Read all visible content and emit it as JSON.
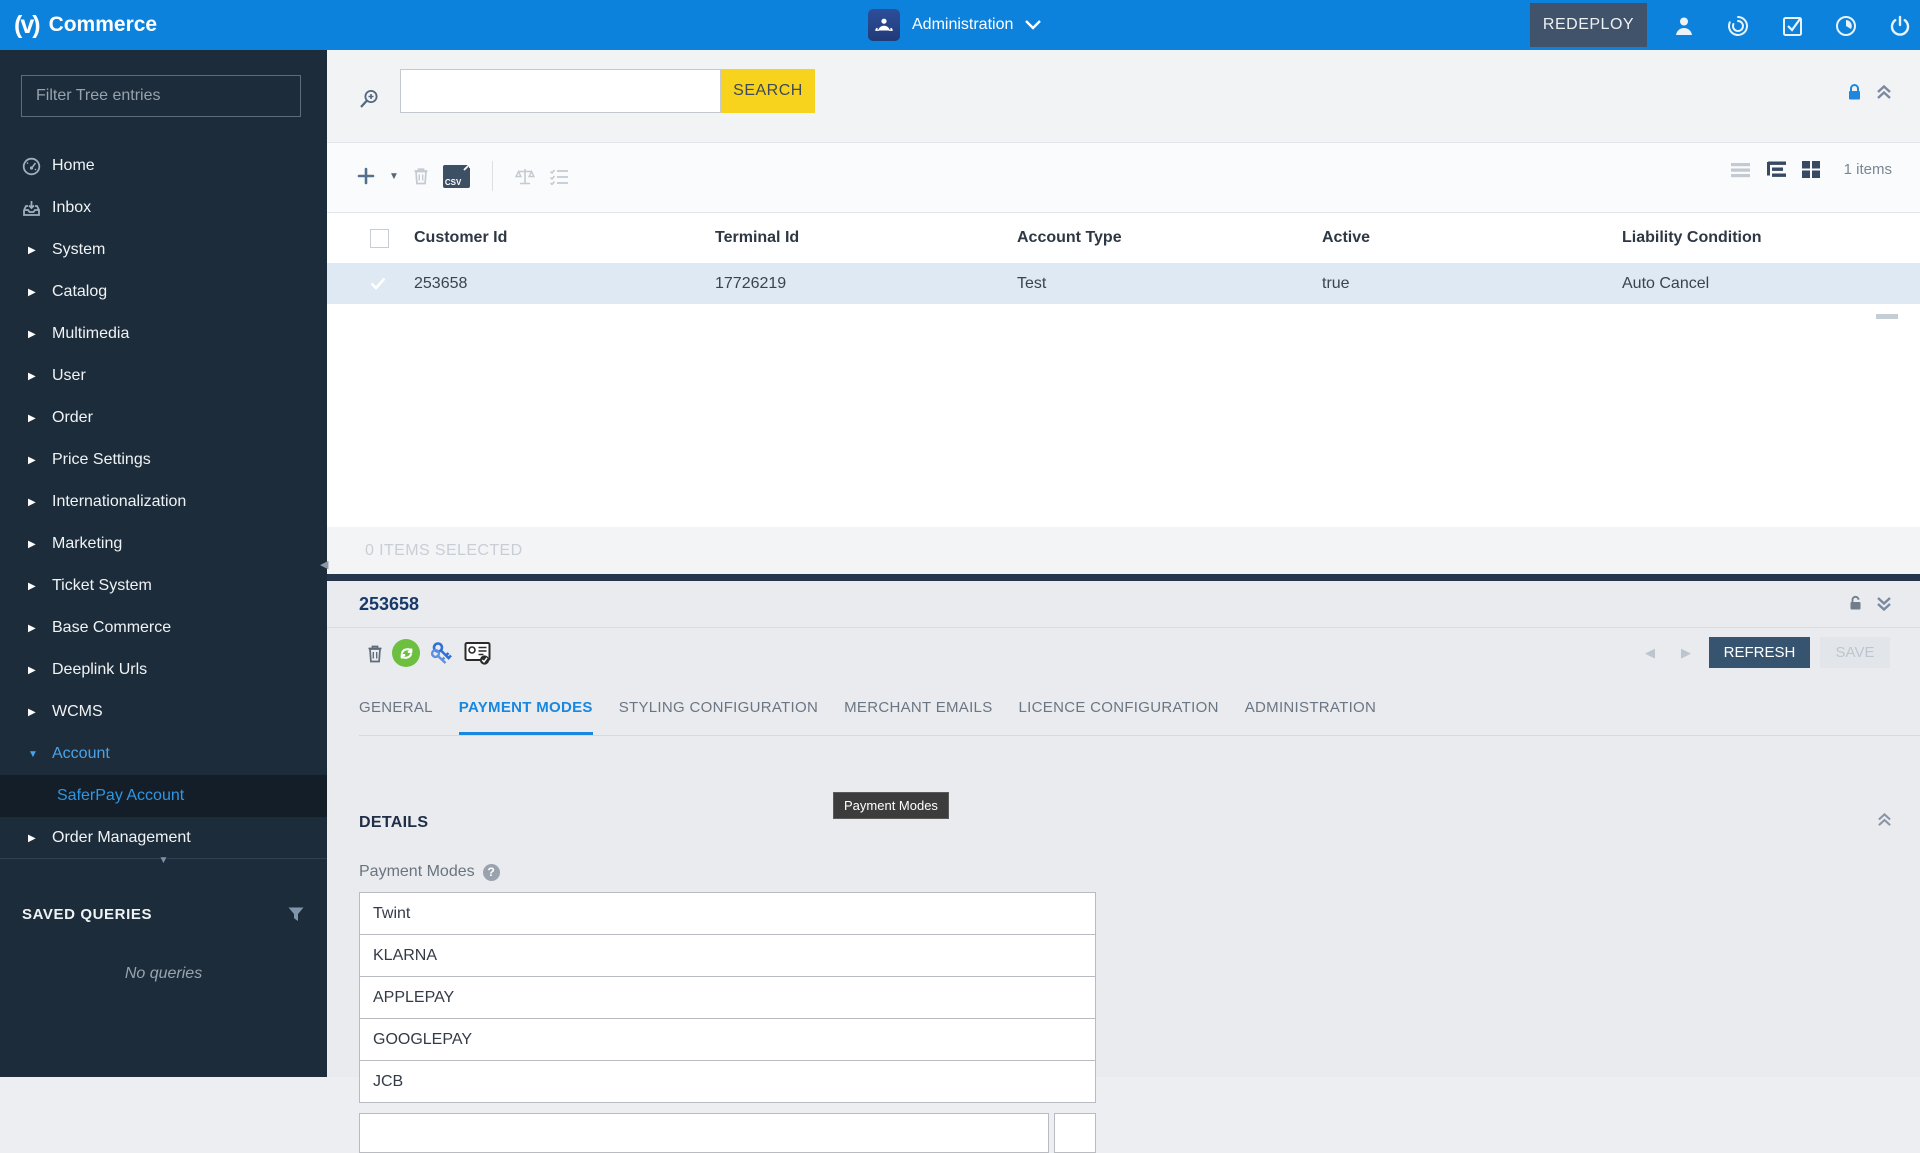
{
  "topbar": {
    "brand": "Commerce",
    "logo_glyph": "(v)",
    "context_label": "Administration",
    "redeploy_label": "REDEPLOY"
  },
  "sidebar": {
    "filter_placeholder": "Filter Tree entries",
    "items": [
      {
        "label": "Home"
      },
      {
        "label": "Inbox"
      },
      {
        "label": "System"
      },
      {
        "label": "Catalog"
      },
      {
        "label": "Multimedia"
      },
      {
        "label": "User"
      },
      {
        "label": "Order"
      },
      {
        "label": "Price Settings"
      },
      {
        "label": "Internationalization"
      },
      {
        "label": "Marketing"
      },
      {
        "label": "Ticket System"
      },
      {
        "label": "Base Commerce"
      },
      {
        "label": "Deeplink Urls"
      },
      {
        "label": "WCMS"
      },
      {
        "label": "Account"
      },
      {
        "label": "SaferPay Account"
      },
      {
        "label": "Order Management"
      }
    ],
    "saved_queries": {
      "title": "SAVED QUERIES",
      "empty_text": "No queries"
    }
  },
  "search": {
    "button_label": "SEARCH",
    "input_value": ""
  },
  "list_panel": {
    "toolbar": {
      "csv_label": "CSV"
    },
    "items_count": "1 items",
    "selection_text": "0 ITEMS SELECTED",
    "table": {
      "columns": [
        "Customer Id",
        "Terminal Id",
        "Account Type",
        "Active",
        "Liability Condition"
      ],
      "rows": [
        {
          "customer_id": "253658",
          "terminal_id": "17726219",
          "account_type": "Test",
          "active": "true",
          "liability_condition": "Auto Cancel",
          "selected": true
        }
      ]
    }
  },
  "detail_panel": {
    "title": "253658",
    "refresh_label": "REFRESH",
    "save_label": "SAVE",
    "tabs": [
      {
        "label": "GENERAL",
        "active": false
      },
      {
        "label": "PAYMENT MODES",
        "active": true
      },
      {
        "label": "STYLING CONFIGURATION",
        "active": false
      },
      {
        "label": "MERCHANT EMAILS",
        "active": false
      },
      {
        "label": "LICENCE CONFIGURATION",
        "active": false
      },
      {
        "label": "ADMINISTRATION",
        "active": false
      }
    ],
    "tooltip_text": "Payment Modes",
    "section_title": "DETAILS",
    "field_label": "Payment Modes",
    "help_glyph": "?",
    "payment_modes": [
      "Twint",
      "KLARNA",
      "APPLEPAY",
      "GOOGLEPAY",
      "JCB"
    ]
  },
  "colors": {
    "topbar_blue": "#0d82dd",
    "accent_yellow": "#f7d31e",
    "sidebar_bg": "#1d2c3a",
    "selected_row": "#dfe9f3",
    "navy_text": "#173a6b",
    "tab_active_blue": "#1787e0",
    "refresh_bg": "#36536f",
    "sync_green": "#6cbf3f",
    "keys_blue": "#2f6fd6",
    "split_bar": "#24354d"
  }
}
